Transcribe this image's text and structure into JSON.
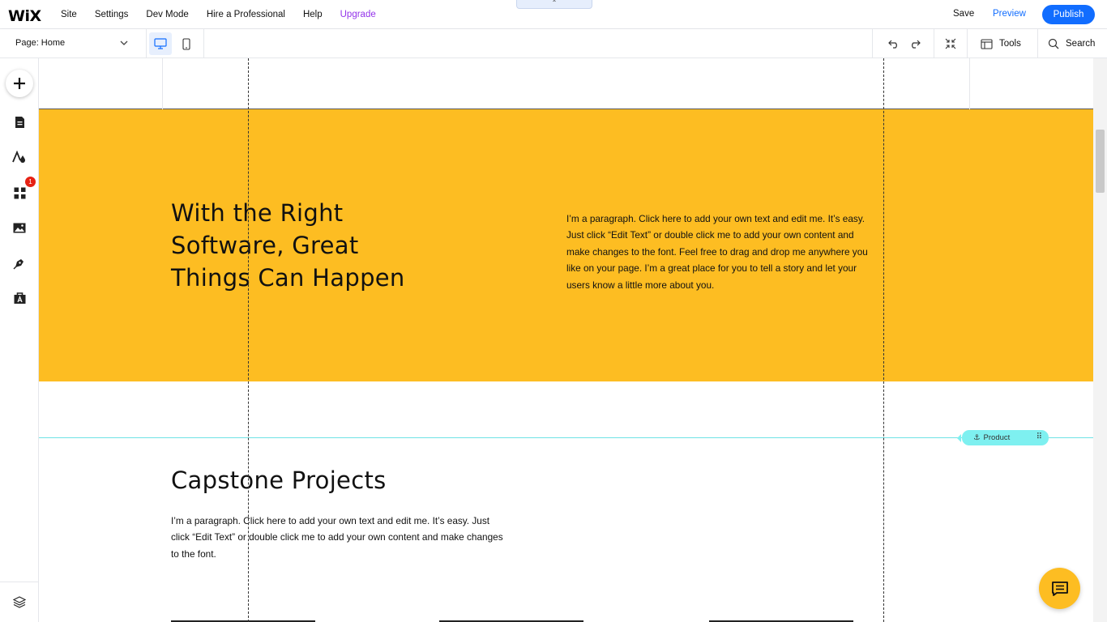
{
  "topbar": {
    "logo": "WiX",
    "menu": [
      "Site",
      "Settings",
      "Dev Mode",
      "Hire a Professional",
      "Help",
      "Upgrade"
    ],
    "save": "Save",
    "preview": "Preview",
    "publish": "Publish"
  },
  "subbar": {
    "page_label": "Page: Home",
    "tools": "Tools",
    "search": "Search"
  },
  "leftrail": {
    "badge_count": "1"
  },
  "canvas": {
    "hero_title_lines": [
      "With the Right",
      "Software, Great",
      "Things Can Happen"
    ],
    "hero_paragraph": "I’m a paragraph. Click here to add your own text and edit me. It’s easy. Just click “Edit Text” or double click me to add your own content and make changes to the font. Feel free to drag and drop me anywhere you like on your page. I’m a great place for you to tell a story and let your users know a little more about you.",
    "anchor_label": "Product",
    "section_title": "Capstone Projects",
    "section_paragraph": "I’m a paragraph. Click here to add your own text and edit me. It’s easy. Just click “Edit Text” or double click me to add your own content and make changes to the font."
  },
  "colors": {
    "accent": "#116dff",
    "upgrade": "#9333ea",
    "hero_bg": "#fdbd22",
    "anchor": "#7ef0f0",
    "badge": "#e62214"
  }
}
